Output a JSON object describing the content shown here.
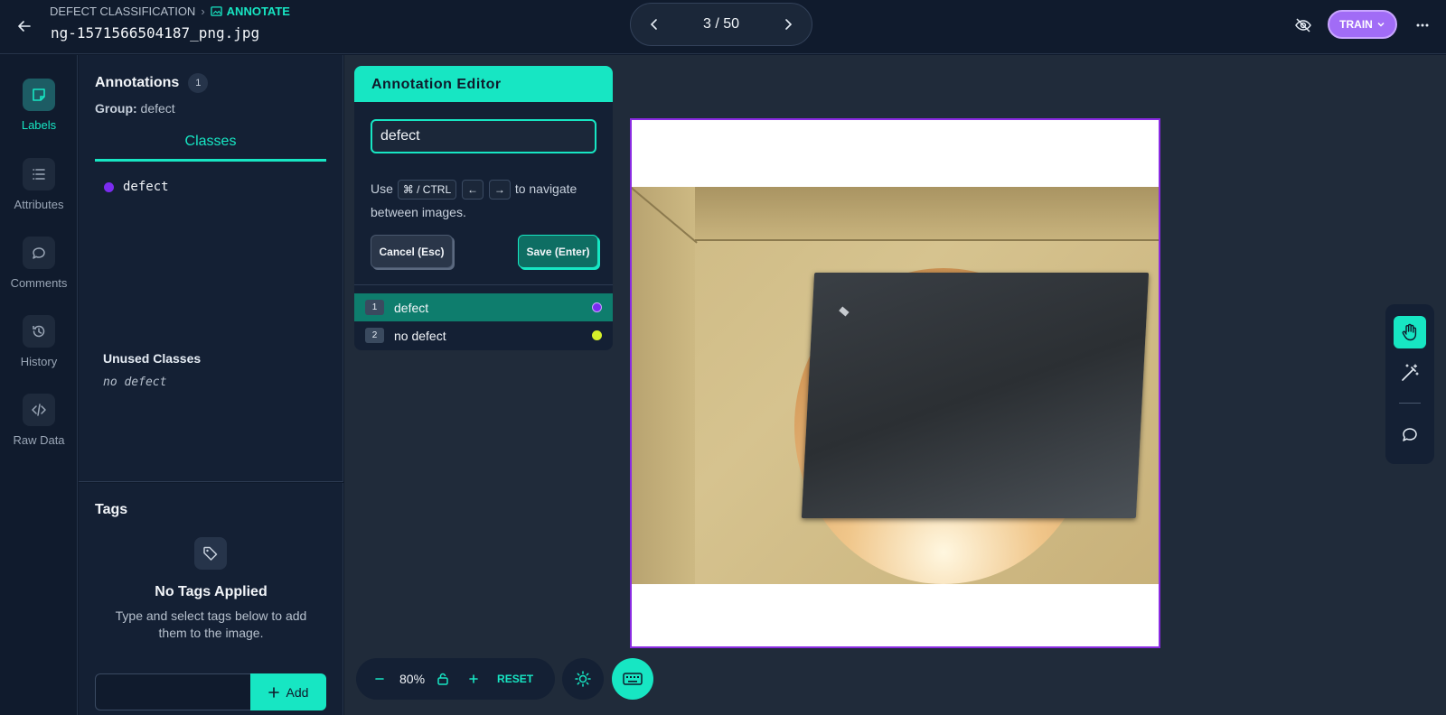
{
  "header": {
    "breadcrumb_project": "DEFECT CLASSIFICATION",
    "breadcrumb_current": "ANNOTATE",
    "filename": "ng-1571566504187_png.jpg",
    "pager": "3 / 50",
    "train_label": "TRAIN"
  },
  "rail": {
    "items": [
      {
        "label": "Labels"
      },
      {
        "label": "Attributes"
      },
      {
        "label": "Comments"
      },
      {
        "label": "History"
      },
      {
        "label": "Raw Data"
      }
    ]
  },
  "annotations": {
    "title": "Annotations",
    "count": "1",
    "group_label": "Group:",
    "group_value": "defect",
    "tab_classes": "Classes",
    "class_name": "defect",
    "class_color": "#7b2cf0",
    "unused_title": "Unused Classes",
    "unused_item": "no defect"
  },
  "tags": {
    "title": "Tags",
    "empty_title": "No Tags Applied",
    "empty_desc": "Type and select tags below to add them to the image.",
    "input_value": "",
    "add_label": "Add"
  },
  "editor": {
    "title": "Annotation Editor",
    "input_value": "defect",
    "hint_use": "Use",
    "kbd_mod": "⌘ / CTRL",
    "kbd_left": "←",
    "kbd_right": "→",
    "hint_rest": "to navigate between images.",
    "cancel_label": "Cancel (Esc)",
    "save_label": "Save (Enter)",
    "options": [
      {
        "num": "1",
        "label": "defect",
        "color": "#7b2cf0"
      },
      {
        "num": "2",
        "label": "no defect",
        "color": "#d6f02a"
      }
    ]
  },
  "zoom": {
    "value": "80%",
    "reset_label": "RESET"
  },
  "colors": {
    "accent": "#17e6c3",
    "train": "#a16cf6",
    "annotation_border": "#8a2be2"
  }
}
